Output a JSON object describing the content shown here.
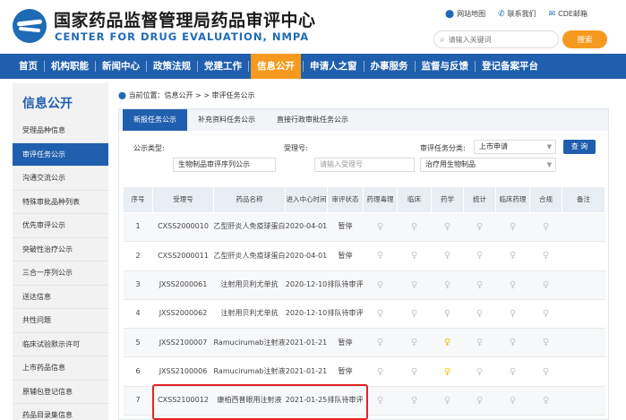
{
  "header": {
    "title_cn": "国家药品监督管理局药品审评中心",
    "title_en": "CENTER FOR DRUG EVALUATION, NMPA",
    "links": [
      {
        "icon": "location-pin-icon",
        "label": "网站地图"
      },
      {
        "icon": "phone-icon",
        "label": "联系我们"
      },
      {
        "icon": "mail-icon",
        "label": "CDE邮箱"
      }
    ],
    "search_placeholder": "请输入关键词",
    "search_button": "搜索"
  },
  "nav": [
    "首页",
    "机构职能",
    "新闻中心",
    "政策法规",
    "党建工作",
    "信息公开",
    "申请人之窗",
    "办事服务",
    "监督与反馈",
    "登记备案平台"
  ],
  "nav_active": "信息公开",
  "sidebar": {
    "title": "信息公开",
    "items": [
      "受理品种信息",
      "审评任务公示",
      "沟通交流公示",
      "特殊审批品种列表",
      "优先审评公示",
      "突破性治疗公示",
      "三合一序列公示",
      "送达信息",
      "共性问题",
      "临床试验默示许可",
      "上市药品信息",
      "原辅包登记信息",
      "药品目录集信息"
    ],
    "active": "审评任务公示"
  },
  "breadcrumb": "当前位置：信息公开 > > 审评任务公示",
  "tabs": [
    "新报任务公示",
    "补充资料任务公示",
    "直接行政审批任务公示"
  ],
  "active_tab": "新报任务公示",
  "filters": {
    "type_label": "公示类型:",
    "type_value": "生物制品审评序列公示",
    "accept_label": "受理号:",
    "accept_placeholder": "请输入受理号",
    "category_label": "审评任务分类:",
    "category_value": "上市申请",
    "category2_value": "治疗用生物制品",
    "query_button": "查 询"
  },
  "table": {
    "headers": [
      "序号",
      "受理号",
      "药品名称",
      "进入中心时间",
      "审评状态",
      "药理毒理",
      "临床",
      "药学",
      "统计",
      "临床药理",
      "合规",
      "备注"
    ],
    "rows": [
      {
        "no": "1",
        "accept": "CXSS2000010",
        "name": "乙型肝炎人免疫球蛋白",
        "time": "2020-04-01",
        "status": "暂停",
        "lights": [
          0,
          0,
          0,
          0,
          0,
          0
        ]
      },
      {
        "no": "2",
        "accept": "CXSS2000011",
        "name": "乙型肝炎人免疫球蛋白",
        "time": "2020-04-01",
        "status": "暂停",
        "lights": [
          0,
          0,
          0,
          0,
          0,
          0
        ]
      },
      {
        "no": "3",
        "accept": "JXSS2000061",
        "name": "注射用贝利尤单抗",
        "time": "2020-12-10",
        "status": "排队待审评",
        "lights": [
          0,
          0,
          0,
          0,
          0,
          0
        ]
      },
      {
        "no": "4",
        "accept": "JXSS2000062",
        "name": "注射用贝利尤单抗",
        "time": "2020-12-10",
        "status": "排队待审评",
        "lights": [
          0,
          0,
          0,
          0,
          0,
          0
        ]
      },
      {
        "no": "5",
        "accept": "JXSS2100007",
        "name": "Ramucirumab注射液",
        "time": "2021-01-21",
        "status": "暂停",
        "lights": [
          0,
          0,
          1,
          0,
          0,
          0
        ]
      },
      {
        "no": "6",
        "accept": "JXSS2100006",
        "name": "Ramucirumab注射液",
        "time": "2021-01-21",
        "status": "暂停",
        "lights": [
          0,
          0,
          1,
          0,
          0,
          0
        ]
      },
      {
        "no": "7",
        "accept": "CXSS2100012",
        "name": "康柏西普眼用注射液",
        "time": "2021-01-25",
        "status": "排队待审评",
        "lights": [
          0,
          0,
          0,
          0,
          0,
          0
        ]
      }
    ]
  },
  "colors": {
    "primary": "#1f5fad",
    "accent": "#f59a1e",
    "highlight": "#e02424",
    "bulb_on": "#f2c200",
    "bulb_off": "#c7c7c7"
  }
}
